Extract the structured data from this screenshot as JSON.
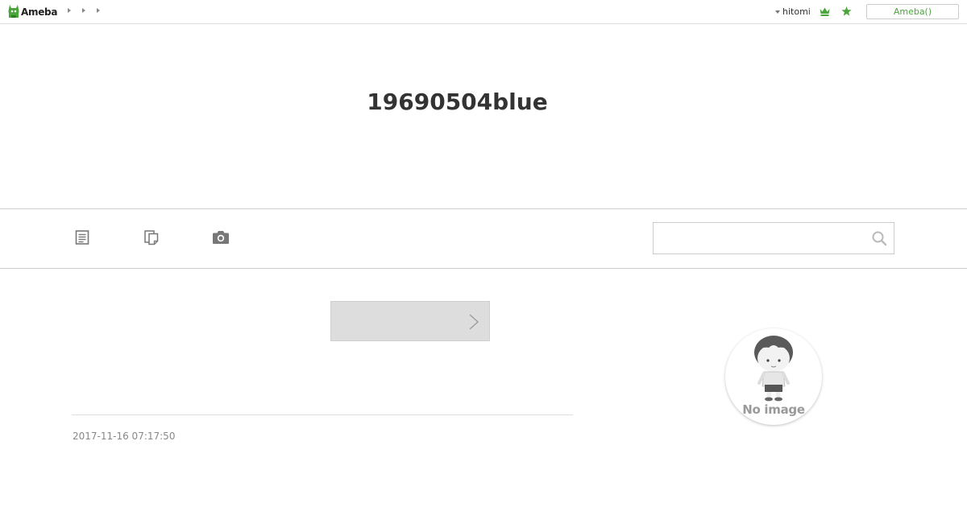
{
  "topbar": {
    "logo_text": "Ameba",
    "breadcrumb_count": 3,
    "user_name": "hitomi",
    "ameba_button_label": "Ameba()"
  },
  "header": {
    "blog_title": "19690504blue"
  },
  "nav": {
    "items": [
      {
        "icon": "article-list-icon"
      },
      {
        "icon": "theme-list-icon"
      },
      {
        "icon": "camera-icon"
      }
    ],
    "search": {
      "value": "",
      "placeholder": ""
    }
  },
  "main": {
    "pager_next_label": "",
    "post_date": "2017-11-16 07:17:50"
  },
  "sidebar": {
    "avatar_text": "No image"
  },
  "colors": {
    "brand_green": "#4aa53b",
    "border": "#cccccc",
    "pager_bg": "#dddddd",
    "muted_text": "#888888"
  }
}
